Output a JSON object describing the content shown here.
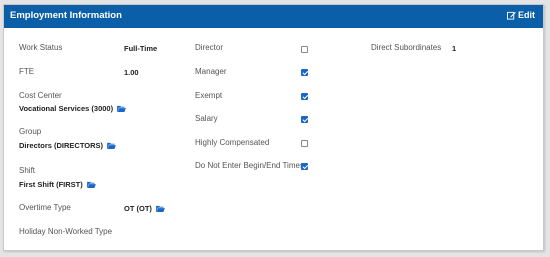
{
  "header": {
    "title": "Employment Information",
    "edit_label": "Edit"
  },
  "left": {
    "work_status": {
      "label": "Work Status",
      "value": "Full-Time"
    },
    "fte": {
      "label": "FTE",
      "value": "1.00"
    },
    "cost_center": {
      "label": "Cost Center",
      "value": "Vocational Services (3000)"
    },
    "group": {
      "label": "Group",
      "value": "Directors (DIRECTORS)"
    },
    "shift": {
      "label": "Shift",
      "value": "First Shift (FIRST)"
    },
    "overtime_type": {
      "label": "Overtime Type",
      "value": "OT (OT)"
    },
    "holiday_type": {
      "label": "Holiday Non-Worked Type",
      "value": ""
    }
  },
  "middle": {
    "director": {
      "label": "Director",
      "checked": false
    },
    "manager": {
      "label": "Manager",
      "checked": true
    },
    "exempt": {
      "label": "Exempt",
      "checked": true
    },
    "salary": {
      "label": "Salary",
      "checked": true
    },
    "highly_compensated": {
      "label": "Highly Compensated",
      "checked": false
    },
    "do_not_enter_times": {
      "label": "Do Not Enter Begin/End Times",
      "checked": true
    }
  },
  "right": {
    "direct_subordinates": {
      "label": "Direct Subordinates",
      "value": "1"
    }
  },
  "colors": {
    "header": "#0a5fa8",
    "checkbox": "#1a66c9",
    "folder_icon": "#1a66c9"
  },
  "icons": {
    "edit": "edit-icon",
    "folder": "folder-open-icon"
  }
}
